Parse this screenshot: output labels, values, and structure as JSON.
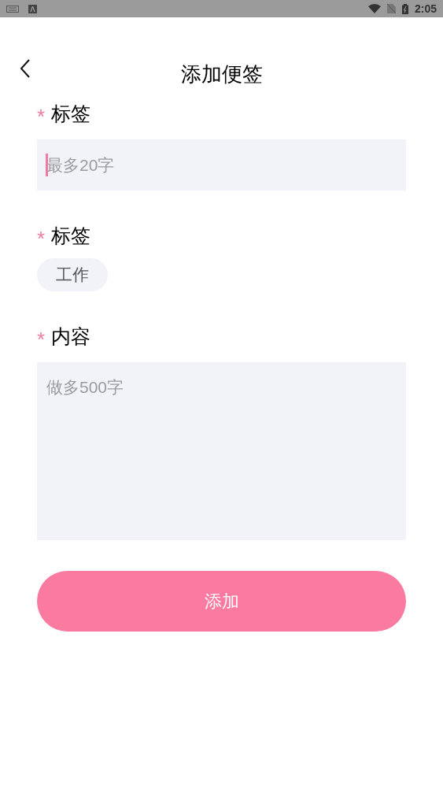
{
  "status_bar": {
    "time": "2:05"
  },
  "header": {
    "title": "添加便签"
  },
  "fields": [
    {
      "kind": "input",
      "required_mark": "*",
      "label": "标签",
      "placeholder": "最多20字",
      "focused": true
    },
    {
      "kind": "tags",
      "required_mark": "*",
      "label": "标签",
      "tags": [
        "工作"
      ]
    },
    {
      "kind": "textarea",
      "required_mark": "*",
      "label": "内容",
      "placeholder": "做多500字",
      "focused": false
    }
  ],
  "submit_button": {
    "label": "添加"
  }
}
